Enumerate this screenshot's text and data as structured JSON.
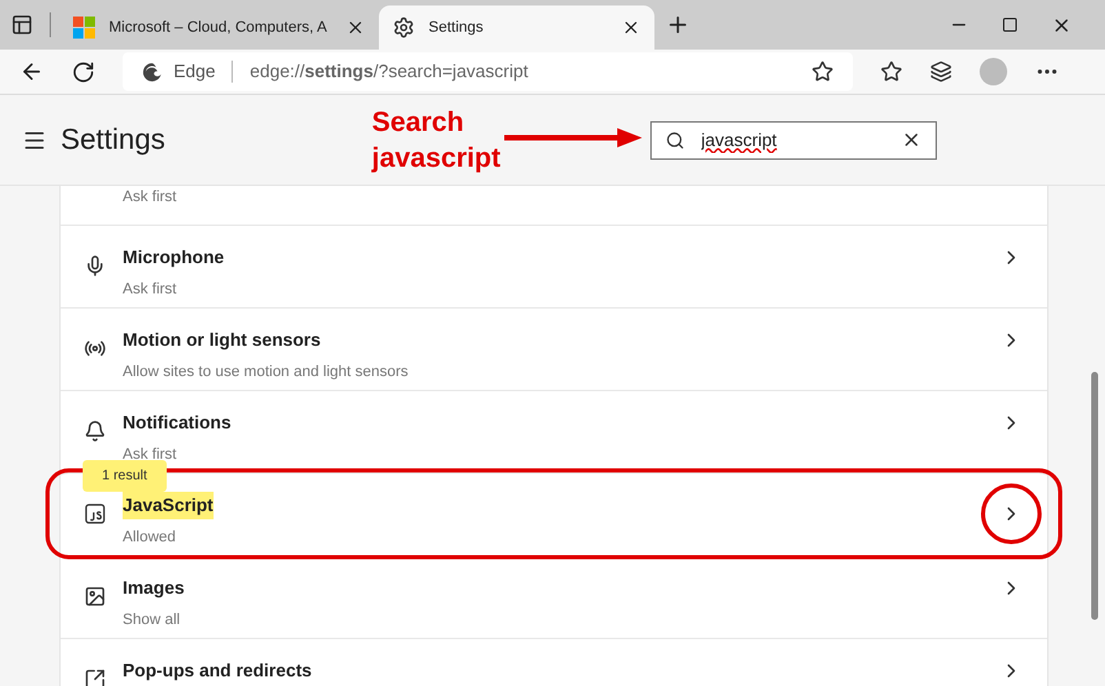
{
  "tabs": [
    {
      "title": "Microsoft – Cloud, Computers, A",
      "kind": "site",
      "selected": false
    },
    {
      "title": "Settings",
      "kind": "settings",
      "selected": true
    }
  ],
  "address_bar": {
    "site_label": "Edge",
    "url": "edge://**settings**/?search=javascript"
  },
  "header": {
    "title": "Settings",
    "search": {
      "value": "javascript"
    }
  },
  "annotation": {
    "label": "Search javascript"
  },
  "rows": [
    {
      "kind": "none",
      "title": "",
      "subtitle": "Ask first",
      "highlighted": false
    },
    {
      "kind": "microphone",
      "title": "Microphone",
      "subtitle": "Ask first",
      "highlighted": false
    },
    {
      "kind": "sensors",
      "title": "Motion or light sensors",
      "subtitle": "Allow sites to use motion and light sensors",
      "highlighted": false
    },
    {
      "kind": "notifications",
      "title": "Notifications",
      "subtitle": "Ask first",
      "highlighted": false
    },
    {
      "kind": "javascript",
      "title": "JavaScript",
      "subtitle": "Allowed",
      "highlighted": true,
      "tooltip": "1 result"
    },
    {
      "kind": "images",
      "title": "Images",
      "subtitle": "Show all",
      "highlighted": false
    },
    {
      "kind": "popups",
      "title": "Pop-ups and redirects",
      "subtitle": "",
      "highlighted": false
    }
  ]
}
